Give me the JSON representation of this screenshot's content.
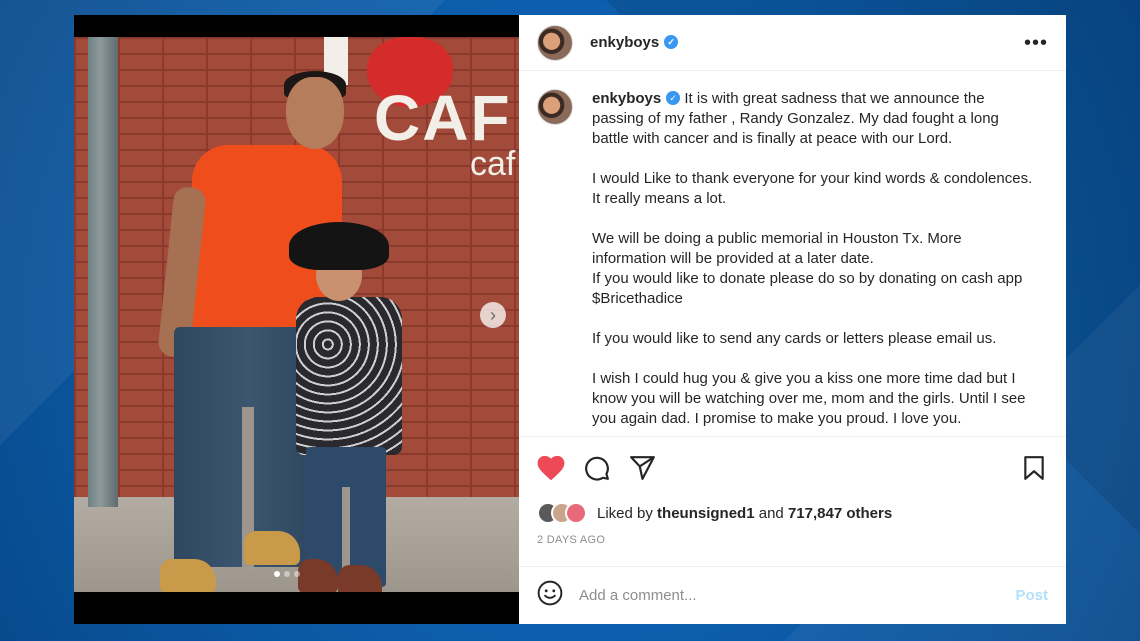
{
  "post": {
    "username": "enkyboys",
    "verified": true,
    "more_icon": "more-horizontal-icon",
    "caption": {
      "username": "enkyboys",
      "paragraphs": [
        "It is with great sadness that we announce the passing of my father , Randy Gonzalez. My dad fought a long battle with cancer and is finally at peace with our Lord.",
        "I would Like to thank everyone for your kind words & condolences. It really means a lot.",
        "We will be doing a public memorial in Houston Tx. More information will be provided at a later date.",
        "If you would like to donate please do so by donating on cash app $Bricethadice",
        "If you would like to send any cards or letters please email us.",
        "I wish I could hug you & give you a kiss one more time dad but I know you will be watching over me, mom and the girls. Until I see you again dad. I promise to make you proud. I love you."
      ]
    },
    "likes": {
      "prefix": "Liked by",
      "liker": "theunsigned1",
      "connector": "and",
      "count_text": "717,847 others"
    },
    "timestamp": "2 DAYS AGO",
    "comment": {
      "placeholder": "Add a comment...",
      "post_label": "Post"
    },
    "image": {
      "sign_text": "I ❤ CAF",
      "sign_subtext": "caf",
      "carousel_position": 1,
      "carousel_total": 3
    }
  },
  "colors": {
    "like_red": "#ed4956",
    "verified_blue": "#3897f0",
    "post_button_disabled": "#b2dffc",
    "background_blue": "#0a5fae"
  }
}
